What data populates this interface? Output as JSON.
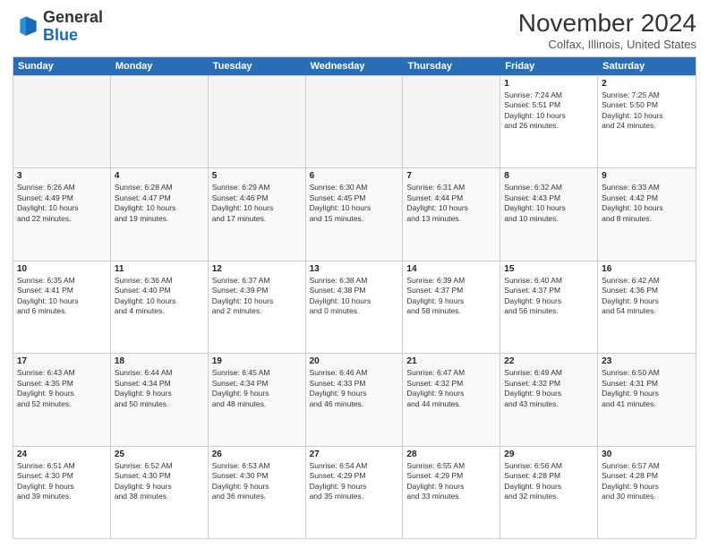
{
  "logo": {
    "general": "General",
    "blue": "Blue"
  },
  "title": "November 2024",
  "location": "Colfax, Illinois, United States",
  "days_of_week": [
    "Sunday",
    "Monday",
    "Tuesday",
    "Wednesday",
    "Thursday",
    "Friday",
    "Saturday"
  ],
  "weeks": [
    [
      {
        "day": "",
        "info": "",
        "empty": true
      },
      {
        "day": "",
        "info": "",
        "empty": true
      },
      {
        "day": "",
        "info": "",
        "empty": true
      },
      {
        "day": "",
        "info": "",
        "empty": true
      },
      {
        "day": "",
        "info": "",
        "empty": true
      },
      {
        "day": "1",
        "info": "Sunrise: 7:24 AM\nSunset: 5:51 PM\nDaylight: 10 hours\nand 26 minutes."
      },
      {
        "day": "2",
        "info": "Sunrise: 7:25 AM\nSunset: 5:50 PM\nDaylight: 10 hours\nand 24 minutes."
      }
    ],
    [
      {
        "day": "3",
        "info": "Sunrise: 6:26 AM\nSunset: 4:49 PM\nDaylight: 10 hours\nand 22 minutes."
      },
      {
        "day": "4",
        "info": "Sunrise: 6:28 AM\nSunset: 4:47 PM\nDaylight: 10 hours\nand 19 minutes."
      },
      {
        "day": "5",
        "info": "Sunrise: 6:29 AM\nSunset: 4:46 PM\nDaylight: 10 hours\nand 17 minutes."
      },
      {
        "day": "6",
        "info": "Sunrise: 6:30 AM\nSunset: 4:45 PM\nDaylight: 10 hours\nand 15 minutes."
      },
      {
        "day": "7",
        "info": "Sunrise: 6:31 AM\nSunset: 4:44 PM\nDaylight: 10 hours\nand 13 minutes."
      },
      {
        "day": "8",
        "info": "Sunrise: 6:32 AM\nSunset: 4:43 PM\nDaylight: 10 hours\nand 10 minutes."
      },
      {
        "day": "9",
        "info": "Sunrise: 6:33 AM\nSunset: 4:42 PM\nDaylight: 10 hours\nand 8 minutes."
      }
    ],
    [
      {
        "day": "10",
        "info": "Sunrise: 6:35 AM\nSunset: 4:41 PM\nDaylight: 10 hours\nand 6 minutes."
      },
      {
        "day": "11",
        "info": "Sunrise: 6:36 AM\nSunset: 4:40 PM\nDaylight: 10 hours\nand 4 minutes."
      },
      {
        "day": "12",
        "info": "Sunrise: 6:37 AM\nSunset: 4:39 PM\nDaylight: 10 hours\nand 2 minutes."
      },
      {
        "day": "13",
        "info": "Sunrise: 6:38 AM\nSunset: 4:38 PM\nDaylight: 10 hours\nand 0 minutes."
      },
      {
        "day": "14",
        "info": "Sunrise: 6:39 AM\nSunset: 4:37 PM\nDaylight: 9 hours\nand 58 minutes."
      },
      {
        "day": "15",
        "info": "Sunrise: 6:40 AM\nSunset: 4:37 PM\nDaylight: 9 hours\nand 56 minutes."
      },
      {
        "day": "16",
        "info": "Sunrise: 6:42 AM\nSunset: 4:36 PM\nDaylight: 9 hours\nand 54 minutes."
      }
    ],
    [
      {
        "day": "17",
        "info": "Sunrise: 6:43 AM\nSunset: 4:35 PM\nDaylight: 9 hours\nand 52 minutes."
      },
      {
        "day": "18",
        "info": "Sunrise: 6:44 AM\nSunset: 4:34 PM\nDaylight: 9 hours\nand 50 minutes."
      },
      {
        "day": "19",
        "info": "Sunrise: 6:45 AM\nSunset: 4:34 PM\nDaylight: 9 hours\nand 48 minutes."
      },
      {
        "day": "20",
        "info": "Sunrise: 6:46 AM\nSunset: 4:33 PM\nDaylight: 9 hours\nand 46 minutes."
      },
      {
        "day": "21",
        "info": "Sunrise: 6:47 AM\nSunset: 4:32 PM\nDaylight: 9 hours\nand 44 minutes."
      },
      {
        "day": "22",
        "info": "Sunrise: 6:49 AM\nSunset: 4:32 PM\nDaylight: 9 hours\nand 43 minutes."
      },
      {
        "day": "23",
        "info": "Sunrise: 6:50 AM\nSunset: 4:31 PM\nDaylight: 9 hours\nand 41 minutes."
      }
    ],
    [
      {
        "day": "24",
        "info": "Sunrise: 6:51 AM\nSunset: 4:30 PM\nDaylight: 9 hours\nand 39 minutes."
      },
      {
        "day": "25",
        "info": "Sunrise: 6:52 AM\nSunset: 4:30 PM\nDaylight: 9 hours\nand 38 minutes."
      },
      {
        "day": "26",
        "info": "Sunrise: 6:53 AM\nSunset: 4:30 PM\nDaylight: 9 hours\nand 36 minutes."
      },
      {
        "day": "27",
        "info": "Sunrise: 6:54 AM\nSunset: 4:29 PM\nDaylight: 9 hours\nand 35 minutes."
      },
      {
        "day": "28",
        "info": "Sunrise: 6:55 AM\nSunset: 4:29 PM\nDaylight: 9 hours\nand 33 minutes."
      },
      {
        "day": "29",
        "info": "Sunrise: 6:56 AM\nSunset: 4:28 PM\nDaylight: 9 hours\nand 32 minutes."
      },
      {
        "day": "30",
        "info": "Sunrise: 6:57 AM\nSunset: 4:28 PM\nDaylight: 9 hours\nand 30 minutes."
      }
    ]
  ]
}
